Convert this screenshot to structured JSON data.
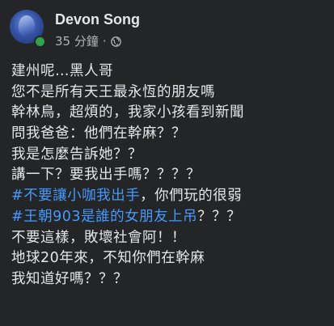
{
  "post": {
    "author": {
      "name": "Devon Song",
      "avatar_icon": "avatar-icon",
      "online_indicator_color": "#31a24c"
    },
    "meta": {
      "time": "35 分鐘",
      "separator": "·",
      "privacy_icon": "globe-icon"
    },
    "lines": [
      {
        "text": "建州呢…黑人哥"
      },
      {
        "text": "您不是所有天王最永恆的朋友嗎"
      },
      {
        "text": "幹林鳥，超煩的，我家小孩看到新聞"
      },
      {
        "text": "問我爸爸：他們在幹麻？？"
      },
      {
        "text": "我是怎麼告訴她？？"
      },
      {
        "text": "講一下？要我出手嗎？？？？"
      },
      {
        "hashtag": "#不要讓小咖我出手",
        "text": "，你們玩的很弱"
      },
      {
        "hashtag": "#王朝903是誰的女朋友上吊",
        "text": "？？？"
      },
      {
        "text": "不要這樣，敗壞社會阿！！"
      },
      {
        "text": "地球20年來，不知你們在幹麻"
      },
      {
        "text": "我知道好嗎？？？"
      }
    ],
    "colors": {
      "background": "#242526",
      "text": "#e4e6eb",
      "secondary_text": "#b0b3b8",
      "hashtag": "#4599ff"
    }
  }
}
